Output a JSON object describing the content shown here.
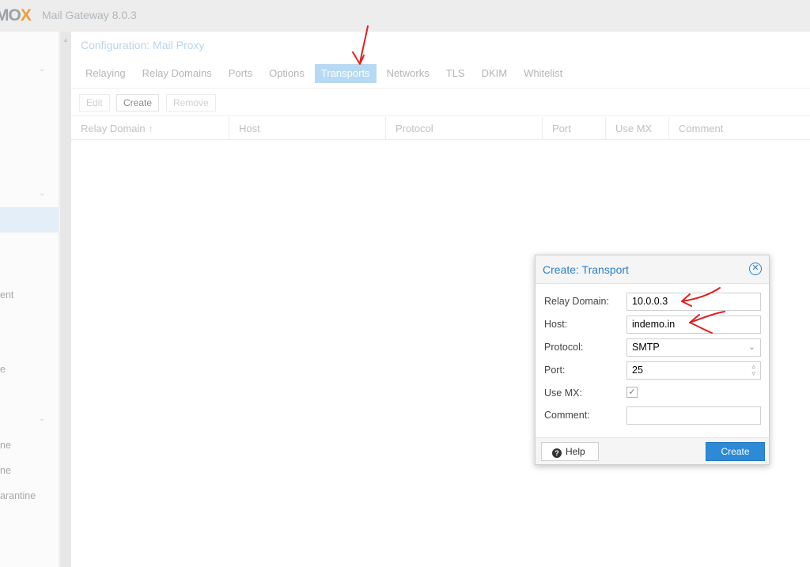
{
  "app": {
    "logo_main": "MO",
    "logo_x": "X",
    "title": "Mail Gateway 8.0.3"
  },
  "sidebar": {
    "items": [
      {
        "label": "ent"
      },
      {
        "label": "e"
      },
      {
        "label": "ne"
      },
      {
        "label": "ne"
      },
      {
        "label": "arantine"
      }
    ]
  },
  "panel": {
    "title": "Configuration: Mail Proxy",
    "tabs": [
      {
        "label": "Relaying"
      },
      {
        "label": "Relay Domains"
      },
      {
        "label": "Ports"
      },
      {
        "label": "Options"
      },
      {
        "label": "Transports",
        "active": true
      },
      {
        "label": "Networks"
      },
      {
        "label": "TLS"
      },
      {
        "label": "DKIM"
      },
      {
        "label": "Whitelist"
      }
    ],
    "toolbar": {
      "edit": "Edit",
      "create": "Create",
      "remove": "Remove"
    },
    "columns": [
      "Relay Domain",
      "Host",
      "Protocol",
      "Port",
      "Use MX",
      "Comment"
    ]
  },
  "dialog": {
    "title": "Create: Transport",
    "fields": {
      "relay_domain": {
        "label": "Relay Domain:",
        "value": "10.0.0.3"
      },
      "host": {
        "label": "Host:",
        "value": "indemo.in"
      },
      "protocol": {
        "label": "Protocol:",
        "value": "SMTP"
      },
      "port": {
        "label": "Port:",
        "value": "25"
      },
      "use_mx": {
        "label": "Use MX:",
        "checked": true
      },
      "comment": {
        "label": "Comment:",
        "value": ""
      }
    },
    "help_label": "Help",
    "create_label": "Create"
  },
  "colors": {
    "accent": "#2d8ad6",
    "active_tab": "#b8d9f3",
    "annotation": "#e02020"
  }
}
